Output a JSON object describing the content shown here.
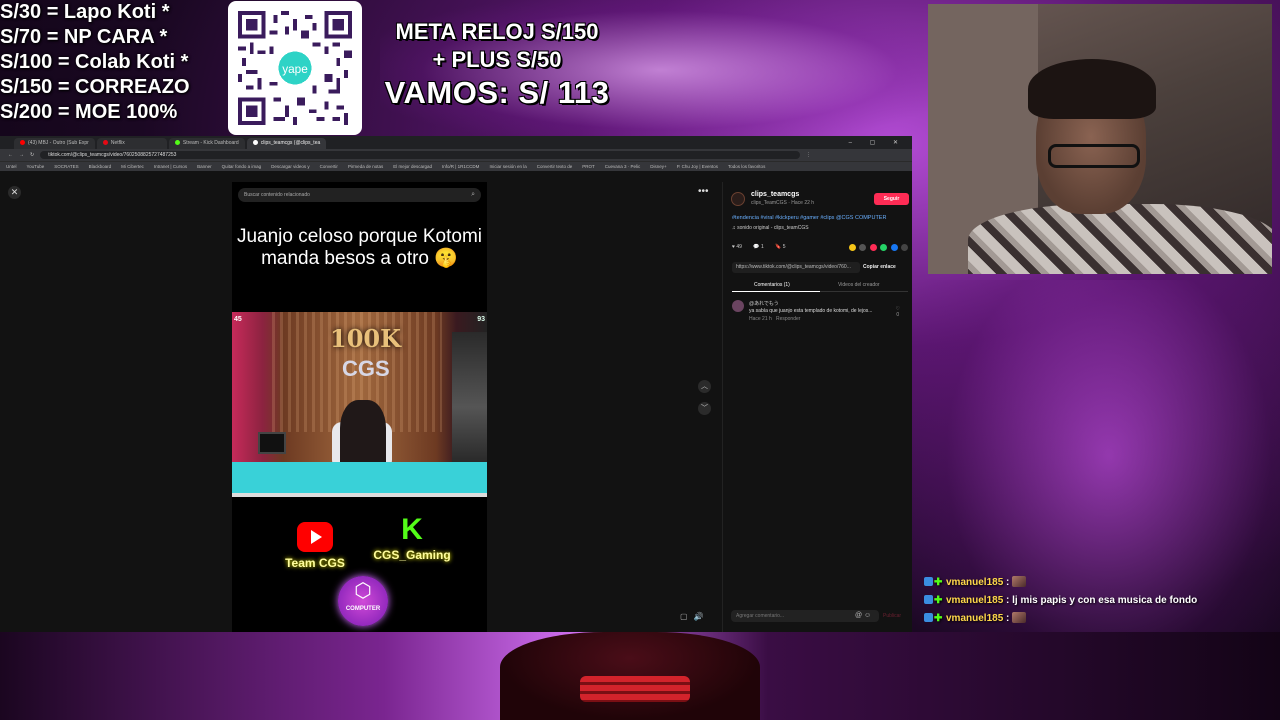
{
  "goals": [
    "S/30 = Lapo Koti *",
    "S/70 =  NP CARA *",
    "S/100 = Colab Koti *",
    "S/150 = CORREAZO",
    "S/200 = MOE 100%"
  ],
  "qr": {
    "brand": "yape"
  },
  "meta": {
    "line1": "META RELOJ S/150",
    "line2": "+ PLUS S/50",
    "line3": "VAMOS: S/ 113"
  },
  "browser": {
    "tabs": [
      {
        "label": "(43) MBJ - Outro (Sub Expr",
        "color": "#ff0000"
      },
      {
        "label": "Netflix",
        "color": "#e50914"
      },
      {
        "label": "Stream - Kick Dashboard",
        "color": "#53fc18"
      },
      {
        "label": "clips_teamcgs (@clips_tea",
        "color": "#ffffff",
        "active": true
      }
    ],
    "window_controls": "– ▢ ✕",
    "url": "tiktok.com/@clips_teamcgs/video/7602508825727487253",
    "bookmarks": [
      "Untel",
      "YouTube",
      "SOCRATES",
      "Blackboard",
      "Mi Cibertec",
      "Intranet | Cursos",
      "Banner",
      "Quitar fondo a imag",
      "Descargar videos y",
      "Convertir",
      "Pirmeda de notas",
      "El mejor descargad",
      "Info/R | 1R1CCDM",
      "Iniciar sesión en la",
      "Convertir texto de",
      "PROT",
      "Cuevana 3 · Pelic",
      "Disney+",
      "P. Chu Joy | Eventos",
      "Todos los favoritos"
    ]
  },
  "video": {
    "search_placeholder": "Buscar contenido relacionado",
    "caption": "Juanjo celoso porque Kotomi manda besos a otro 🤫",
    "milestone": "100K",
    "studio_logo": "CGS",
    "left_badge": "45",
    "right_badge": "93",
    "youtube_label": "Team CGS",
    "kick_label": "CGS_Gaming",
    "computer_label": "COMPUTER"
  },
  "panel": {
    "username": "clips_teamcgs",
    "subline": "clips_TeamCGS · Hace 22 h",
    "follow": "Seguir",
    "tags": "#tendencia #viral #kickperu #gamer #clips @CGS COMPUTER",
    "sound": "♫ sonido original - clips_teamCGS",
    "likes": "49",
    "comments": "1",
    "saves": "5",
    "link": "https://www.tiktok.com/@clips_teamcgs/video/760...",
    "copy_link": "Copiar enlace",
    "tab_comments": "Comentarios (1)",
    "tab_creator": "Videos del creador",
    "comment_user": "@あれでもう",
    "comment_text": "ya sabía que juanjo esta templado de kotomi, de lejos...",
    "comment_time": "Hace 21 h",
    "comment_reply": "Responder",
    "comment_likes": "0",
    "input_placeholder": "Agregar comentario...",
    "post": "Publicar"
  },
  "chat": [
    {
      "name": "vmanuel185",
      "msg": "",
      "emote": true
    },
    {
      "name": "vmanuel185",
      "msg": "lj mis papis y con esa musica de fondo",
      "emote": false
    },
    {
      "name": "vmanuel185",
      "msg": "",
      "emote": true
    }
  ]
}
